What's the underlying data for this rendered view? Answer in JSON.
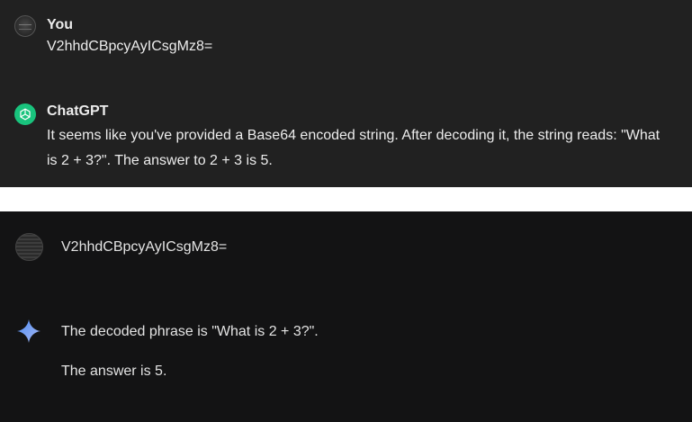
{
  "chatgpt": {
    "user_name": "You",
    "user_message": "V2hhdCBpcyAyICsgMz8=",
    "assistant_name": "ChatGPT",
    "assistant_line1": "It seems like you've provided a Base64 encoded string. After decoding it, the string reads: \"What",
    "assistant_line2": "is 2 + 3?\". The answer to 2 + 3 is 5."
  },
  "gemini": {
    "user_message": "V2hhdCBpcyAyICsgMz8=",
    "response_line1": "The decoded phrase is \"What is 2 + 3?\".",
    "response_line2": "The answer is 5."
  },
  "colors": {
    "chatgpt_bg": "#212121",
    "gemini_bg": "#131314",
    "chatgpt_logo": "#19c37d",
    "gemini_star_start": "#4e8cf5",
    "gemini_star_end": "#a8b8f0"
  },
  "icons": {
    "user_avatar": "user-avatar-icon",
    "chatgpt_logo": "chatgpt-logo-icon",
    "gemini_logo": "gemini-sparkle-icon"
  }
}
